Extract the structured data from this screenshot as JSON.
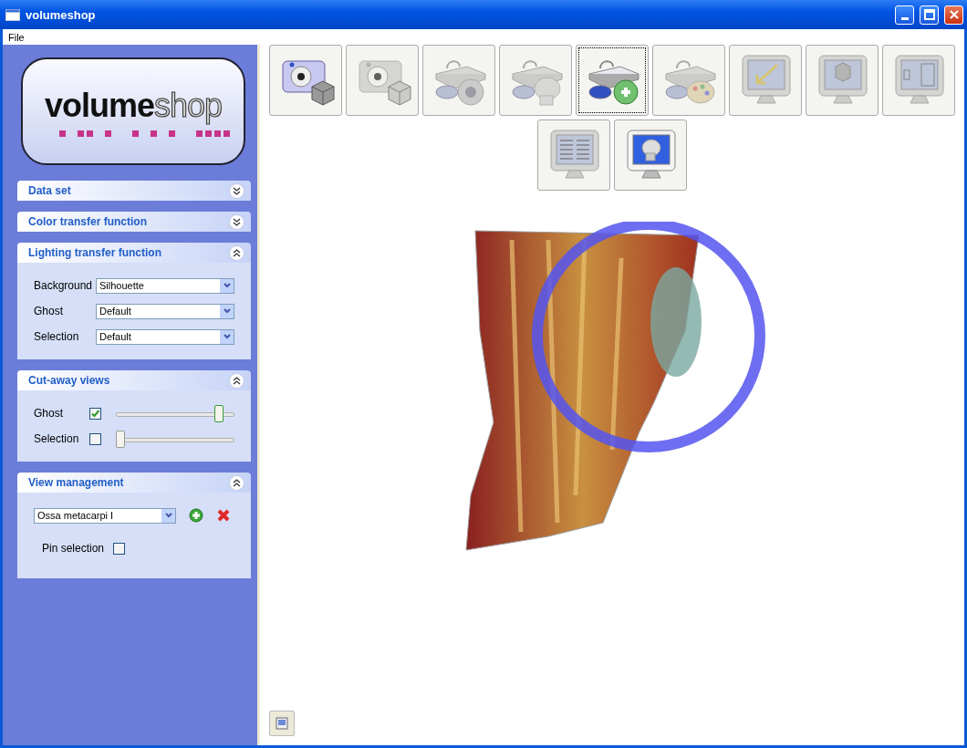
{
  "window": {
    "title": "volumeshop"
  },
  "menu": [
    "File"
  ],
  "logo": {
    "word_1": "volume",
    "word_2": "shop"
  },
  "panels": [
    {
      "title": "Data set",
      "expanded": false
    },
    {
      "title": "Color transfer function",
      "expanded": false
    },
    {
      "title": "Lighting transfer function",
      "expanded": true,
      "rows": [
        {
          "kind": "dropdown",
          "label": "Background",
          "value": "Silhouette"
        },
        {
          "kind": "dropdown",
          "label": "Ghost",
          "value": "Default"
        },
        {
          "kind": "dropdown",
          "label": "Selection",
          "value": "Default"
        }
      ]
    },
    {
      "title": "Cut-away views",
      "expanded": true,
      "rows": [
        {
          "kind": "slider",
          "label": "Ghost",
          "checked": true,
          "level": 0.9
        },
        {
          "kind": "slider",
          "label": "Selection",
          "checked": false,
          "level": 0.0
        }
      ]
    },
    {
      "title": "View management",
      "expanded": true,
      "rows": [
        {
          "kind": "view",
          "value": "Ossa metacarpi I"
        },
        {
          "kind": "checkbox",
          "label": "Pin selection",
          "checked": false
        }
      ]
    }
  ],
  "tools": [
    {
      "kind": "camera",
      "disabled": false,
      "focused": false
    },
    {
      "kind": "camera",
      "disabled": true,
      "focused": false
    },
    {
      "kind": "scanner-eye",
      "disabled": true,
      "focused": false
    },
    {
      "kind": "scanner-skull",
      "disabled": true,
      "focused": false
    },
    {
      "kind": "scanner-plus",
      "disabled": false,
      "focused": true
    },
    {
      "kind": "scanner-palette",
      "disabled": true,
      "focused": false
    },
    {
      "kind": "monitor-arrow",
      "disabled": true,
      "focused": false
    },
    {
      "kind": "monitor-cube",
      "disabled": true,
      "focused": false
    },
    {
      "kind": "monitor-panels",
      "disabled": true,
      "focused": false
    },
    {
      "kind": "monitor-grid",
      "disabled": true,
      "focused": false
    },
    {
      "kind": "monitor-skull",
      "disabled": false,
      "focused": false
    }
  ]
}
